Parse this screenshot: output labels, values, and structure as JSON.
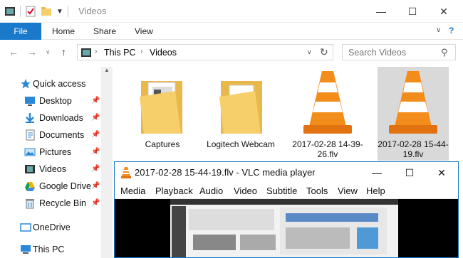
{
  "explorer": {
    "window_title": "Videos",
    "ribbon_tabs": [
      "File",
      "Home",
      "Share",
      "View"
    ],
    "breadcrumb": [
      "This PC",
      "Videos"
    ],
    "search_placeholder": "Search Videos",
    "nav_items": [
      {
        "label": "Quick access",
        "icon": "star-icon",
        "pinned": false
      },
      {
        "label": "Desktop",
        "icon": "desktop-icon",
        "pinned": true
      },
      {
        "label": "Downloads",
        "icon": "download-icon",
        "pinned": true
      },
      {
        "label": "Documents",
        "icon": "documents-icon",
        "pinned": true
      },
      {
        "label": "Pictures",
        "icon": "pictures-icon",
        "pinned": true
      },
      {
        "label": "Videos",
        "icon": "videos-icon",
        "pinned": true
      },
      {
        "label": "Google Drive",
        "icon": "google-drive-icon",
        "pinned": true
      },
      {
        "label": "Recycle Bin",
        "icon": "recycle-bin-icon",
        "pinned": true
      },
      {
        "label": "OneDrive",
        "icon": "onedrive-icon",
        "pinned": false
      },
      {
        "label": "This PC",
        "icon": "this-pc-icon",
        "pinned": false
      }
    ],
    "files": [
      {
        "label": "Captures",
        "type": "folder"
      },
      {
        "label": "Logitech Webcam",
        "type": "folder"
      },
      {
        "label": "2017-02-28 14-39-26.flv",
        "type": "vlc"
      },
      {
        "label": "2017-02-28 15-44-19.flv",
        "type": "vlc",
        "selected": true
      }
    ]
  },
  "vlc": {
    "title": "2017-02-28 15-44-19.flv - VLC media player",
    "menu": [
      "Media",
      "Playback",
      "Audio",
      "Video",
      "Subtitle",
      "Tools",
      "View",
      "Help"
    ]
  },
  "colors": {
    "accent": "#1979ca",
    "vlc_orange": "#f28c1a",
    "folder": "#f6cf6a",
    "selection": "#d9d9d9"
  }
}
